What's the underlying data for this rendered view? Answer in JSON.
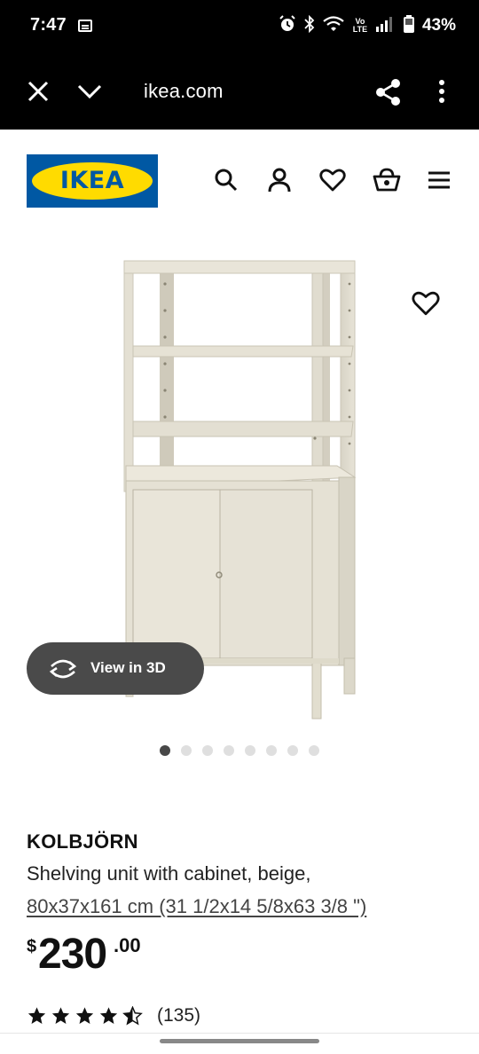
{
  "status_bar": {
    "time": "7:47",
    "volte": "Vo LTE",
    "battery": "43%",
    "icons": [
      "notification-icon",
      "alarm-icon",
      "bluetooth-icon",
      "wifi-icon",
      "volte-icon",
      "signal-icon",
      "battery-icon"
    ]
  },
  "browser": {
    "url": "ikea.com",
    "icons": [
      "close-icon",
      "chevron-down-icon",
      "share-icon",
      "more-vertical-icon"
    ]
  },
  "header": {
    "logo_text": "IKEA",
    "icons": [
      "search-icon",
      "account-icon",
      "heart-icon",
      "basket-icon",
      "menu-icon"
    ],
    "colors": {
      "logo_blue": "#0058a3",
      "logo_yellow": "#ffdb00"
    }
  },
  "gallery": {
    "view_3d_label": "View in 3D",
    "total_images": 8,
    "active_index": 0
  },
  "product": {
    "name": "KOLBJÖRN",
    "description": "Shelving unit with cabinet, beige,",
    "dimensions": "80x37x161 cm (31 1/2x14 5/8x63 3/8 \")",
    "price": {
      "currency": "$",
      "integer": "230",
      "decimal": ".00"
    },
    "rating": {
      "value": 4.5,
      "max": 5,
      "count": "(135)"
    }
  }
}
